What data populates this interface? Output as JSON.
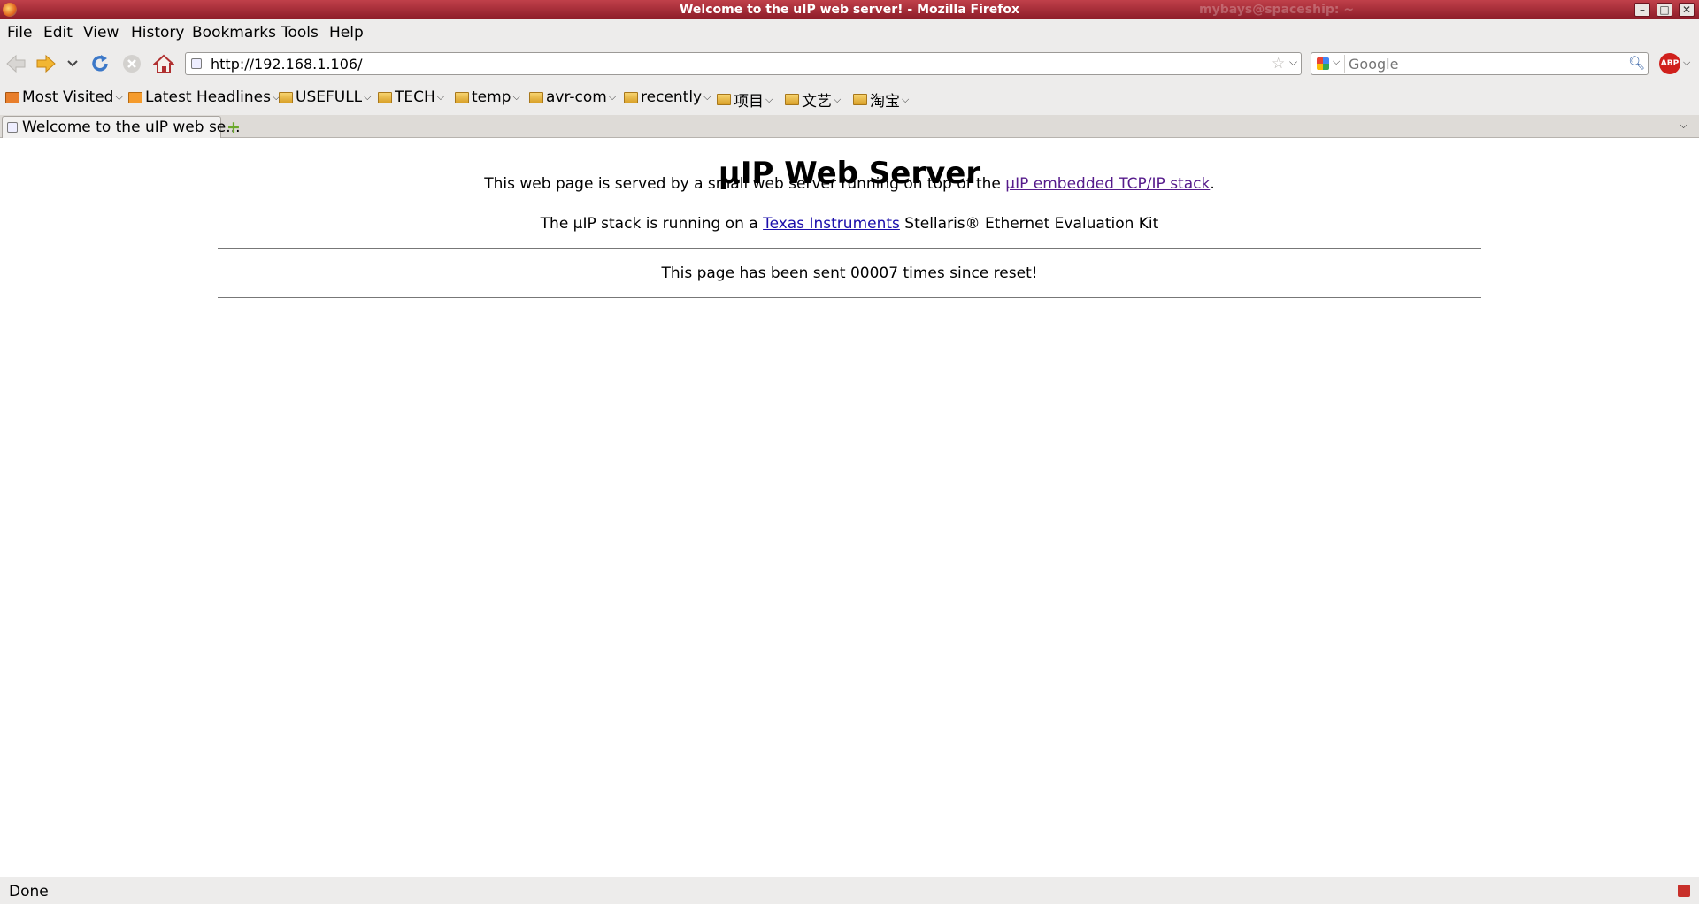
{
  "window": {
    "title": "Welcome to the uIP web server! - Mozilla Firefox",
    "ghost_title": "mybays@spaceship: ~",
    "minimize": "–",
    "maximize": "□",
    "close": "✕"
  },
  "menubar": {
    "items": [
      "File",
      "Edit",
      "View",
      "History",
      "Bookmarks",
      "Tools",
      "Help"
    ]
  },
  "navbar": {
    "url": "http://192.168.1.106/",
    "search_placeholder": "Google",
    "abp_label": "ABP"
  },
  "bookmarks": {
    "items": [
      "Most Visited",
      "Latest Headlines",
      "USEFULL",
      "TECH",
      "temp",
      "avr-com",
      "recently",
      "项目",
      "文艺",
      "淘宝"
    ]
  },
  "tabs": {
    "active_label": "Welcome to the uIP web se...",
    "new_tab": "+"
  },
  "page": {
    "heading": "µIP Web Server",
    "intro_prefix": "This web page is served by a small web server running on top of the ",
    "intro_link": "µIP embedded TCP/IP stack",
    "intro_suffix": ".",
    "stack_prefix": "The µIP stack is running on a ",
    "stack_link": "Texas Instruments",
    "stack_suffix": " Stellaris® Ethernet Evaluation Kit",
    "counter_text": "This page has been sent 00007 times since reset!"
  },
  "statusbar": {
    "text": "Done"
  },
  "colors": {
    "titlebar": "#a82a36",
    "link": "#1a0dab",
    "visited_link": "#551a8b"
  }
}
